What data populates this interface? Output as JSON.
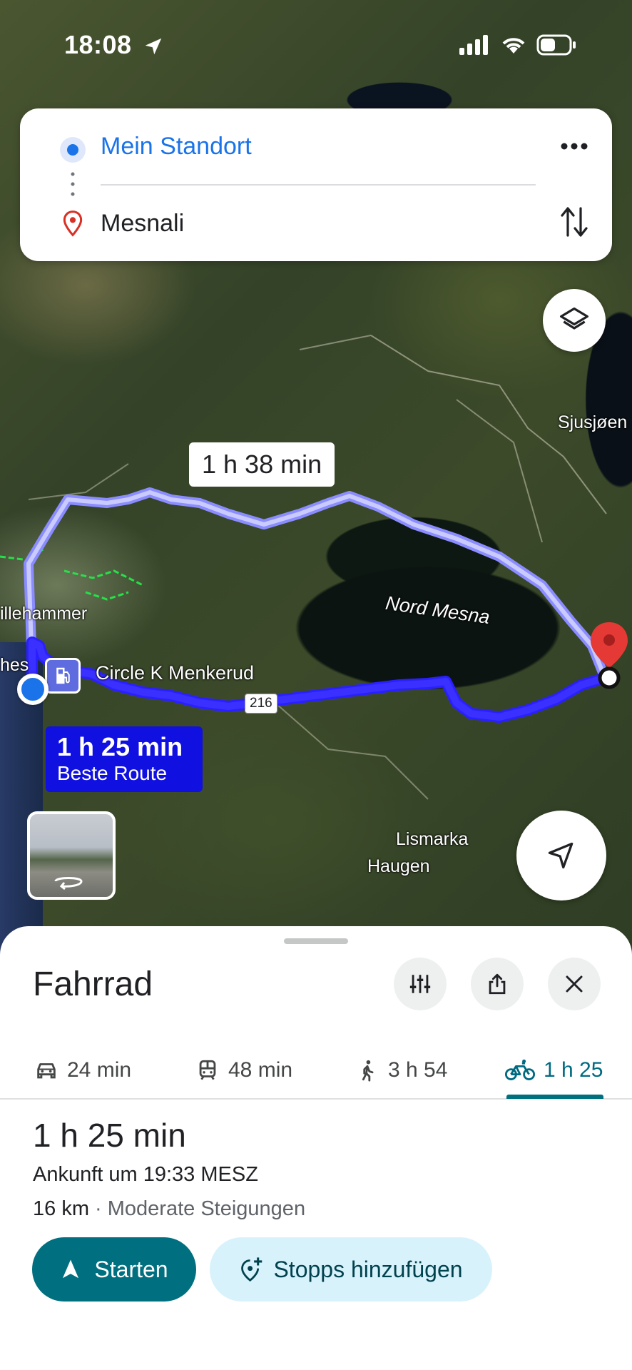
{
  "status_bar": {
    "time": "18:08"
  },
  "route_card": {
    "origin": "Mein Standort",
    "destination": "Mesnali"
  },
  "map": {
    "labels": {
      "sjusjoen": "Sjusjøen",
      "nord_mesna": "Nord Mesna",
      "lillehammer": "illehammer",
      "hes": "hes",
      "circle_k": "Circle K Menkerud",
      "lismarka": "Lismarka",
      "haugen": "Haugen"
    },
    "road_number": "216",
    "alt_route_time": "1 h 38 min",
    "best_route_time": "1 h 25 min",
    "best_route_label": "Beste Route",
    "route_color": "#1010e0",
    "alt_route_color": "#6a6cff",
    "pin_color": "#e53935"
  },
  "sheet": {
    "title": "Fahrrad",
    "modes": [
      {
        "icon": "car-icon",
        "label": "24 min"
      },
      {
        "icon": "transit-icon",
        "label": "48 min"
      },
      {
        "icon": "walk-icon",
        "label": "3 h 54"
      },
      {
        "icon": "bike-icon",
        "label": "1 h 25"
      }
    ],
    "active_mode": "bike",
    "duration": "1 h 25 min",
    "arrival": "Ankunft um 19:33 MESZ",
    "distance": "16 km",
    "terrain": " · Moderate Steigungen",
    "start_label": "Starten",
    "add_stops_label": "Stopps hinzufügen",
    "accent_color": "#006f7f"
  }
}
